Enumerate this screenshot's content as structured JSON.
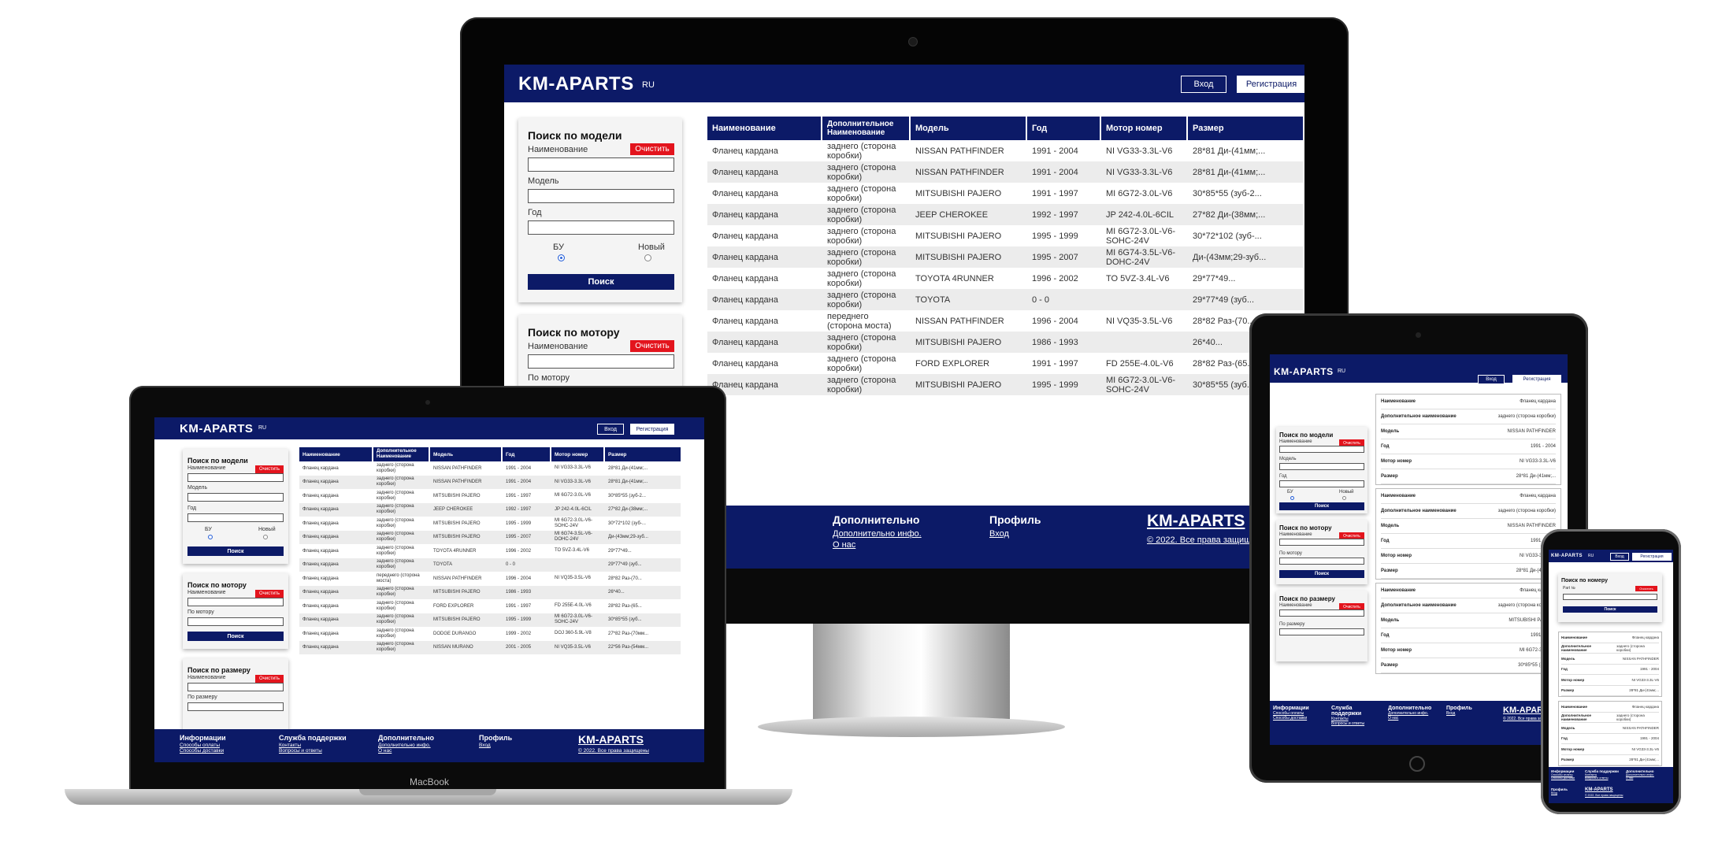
{
  "site": {
    "logo": "KM-APARTS",
    "lang": "RU",
    "login": "Вход",
    "register": "Регистрация",
    "clear": "Очистить",
    "search": "Поиск"
  },
  "search_model": {
    "title": "Поиск по модели",
    "name_label": "Наименование",
    "model_label": "Модель",
    "year_label": "Год",
    "used_label": "БУ",
    "new_label": "Новый"
  },
  "search_motor": {
    "title": "Поиск по мотору",
    "name_label": "Наименование",
    "motor_label": "По мотору"
  },
  "search_size": {
    "title": "Поиск по размеру",
    "name_label": "Наименование",
    "size_label": "По размеру"
  },
  "search_number": {
    "title": "Поиск по номеру",
    "label": "Part №"
  },
  "table": {
    "headers": [
      "Наименование",
      "Дополнительное Наименование",
      "Модель",
      "Год",
      "Мотор номер",
      "Размер"
    ],
    "rows": [
      [
        "Фланец кардана",
        "заднего (сторона коробки)",
        "NISSAN PATHFINDER",
        "1991 - 2004",
        "NI VG33-3.3L-V6",
        "28*81 Ди-(41мм;..."
      ],
      [
        "Фланец кардана",
        "заднего (сторона коробки)",
        "NISSAN PATHFINDER",
        "1991 - 2004",
        "NI VG33-3.3L-V6",
        "28*81 Ди-(41мм;..."
      ],
      [
        "Фланец кардана",
        "заднего (сторона коробки)",
        "MITSUBISHI PAJERO",
        "1991 - 1997",
        "MI 6G72-3.0L-V6",
        "30*85*55 (зуб-2..."
      ],
      [
        "Фланец кардана",
        "заднего (сторона коробки)",
        "JEEP CHEROKEE",
        "1992 - 1997",
        "JP 242-4.0L-6CIL",
        "27*82 Ди-(38мм;..."
      ],
      [
        "Фланец кардана",
        "заднего (сторона коробки)",
        "MITSUBISHI PAJERO",
        "1995 - 1999",
        "MI 6G72-3.0L-V6-SOHC-24V",
        "30*72*102 (зуб-..."
      ],
      [
        "Фланец кардана",
        "заднего (сторона коробки)",
        "MITSUBISHI PAJERO",
        "1995 - 2007",
        "MI 6G74-3.5L-V6-DOHC-24V",
        "Ди-(43мм;29-зуб..."
      ],
      [
        "Фланец кардана",
        "заднего (сторона коробки)",
        "TOYOTA 4RUNNER",
        "1996 - 2002",
        "TO 5VZ-3.4L-V6",
        "29*77*49..."
      ],
      [
        "Фланец кардана",
        "заднего (сторона коробки)",
        "TOYOTA",
        "0 - 0",
        "",
        "29*77*49 (зуб..."
      ],
      [
        "Фланец кардана",
        "переднего (сторона моста)",
        "NISSAN PATHFINDER",
        "1996 - 2004",
        "NI VQ35-3.5L-V6",
        "28*82 Раз-(70..."
      ],
      [
        "Фланец кардана",
        "заднего (сторона коробки)",
        "MITSUBISHI PAJERO",
        "1986 - 1993",
        "",
        "26*40..."
      ],
      [
        "Фланец кардана",
        "заднего (сторона коробки)",
        "FORD EXPLORER",
        "1991 - 1997",
        "FD 255E-4.0L-V6",
        "28*82 Раз-(65..."
      ],
      [
        "Фланец кардана",
        "заднего (сторона коробки)",
        "MITSUBISHI PAJERO",
        "1995 - 1999",
        "MI 6G72-3.0L-V6-SOHC-24V",
        "30*85*55 (зуб..."
      ]
    ],
    "laptop_extra_rows": [
      [
        "Фланец кардана",
        "заднего (сторона коробки)",
        "DODGE DURANGO",
        "1999 - 2002",
        "DOJ 360-5.9L-V8",
        "27*82 Раз-(70мм..."
      ],
      [
        "Фланец кардана",
        "заднего (сторона коробки)",
        "NISSAN MURANO",
        "2001 - 2005",
        "NI VQ35-3.5L-V6",
        "22*56 Раз-(54мм..."
      ]
    ]
  },
  "cards": {
    "keys": [
      "Наименование",
      "Дополнительное наименование",
      "Модель",
      "Год",
      "Мотор номер",
      "Размер"
    ],
    "items": [
      [
        "Фланец кардана",
        "заднего (сторона коробки)",
        "NISSAN PATHFINDER",
        "1991 - 2004",
        "NI VG33-3.3L-V6",
        "28*81 Ди-(41мм;..."
      ],
      [
        "Фланец кардана",
        "заднего (сторона коробки)",
        "NISSAN PATHFINDER",
        "1991 - 2004",
        "NI VG33-3.3L-V6",
        "28*81 Ди-(41мм;..."
      ],
      [
        "Фланец кардана",
        "заднего (сторона коробки)",
        "MITSUBISHI PAJERO",
        "1991 - 1997",
        "MI 6G72-3.0L-V6",
        "30*85*55 (зуб-2..."
      ]
    ]
  },
  "footer": {
    "info_title": "Информации",
    "info_links": [
      "Способы оплаты",
      "Способы доставки"
    ],
    "support_title": "Служба поддержки",
    "support_links": [
      "Контакты",
      "Вопросы и ответы"
    ],
    "extra_title": "Дополнительно",
    "extra_links": [
      "Дополнительно инфо.",
      "О нас"
    ],
    "profile_title": "Профиль",
    "profile_links": [
      "Вход"
    ],
    "copyright": "© 2022. Все права защищены"
  },
  "devices": {
    "laptop_brand": "MacBook"
  }
}
